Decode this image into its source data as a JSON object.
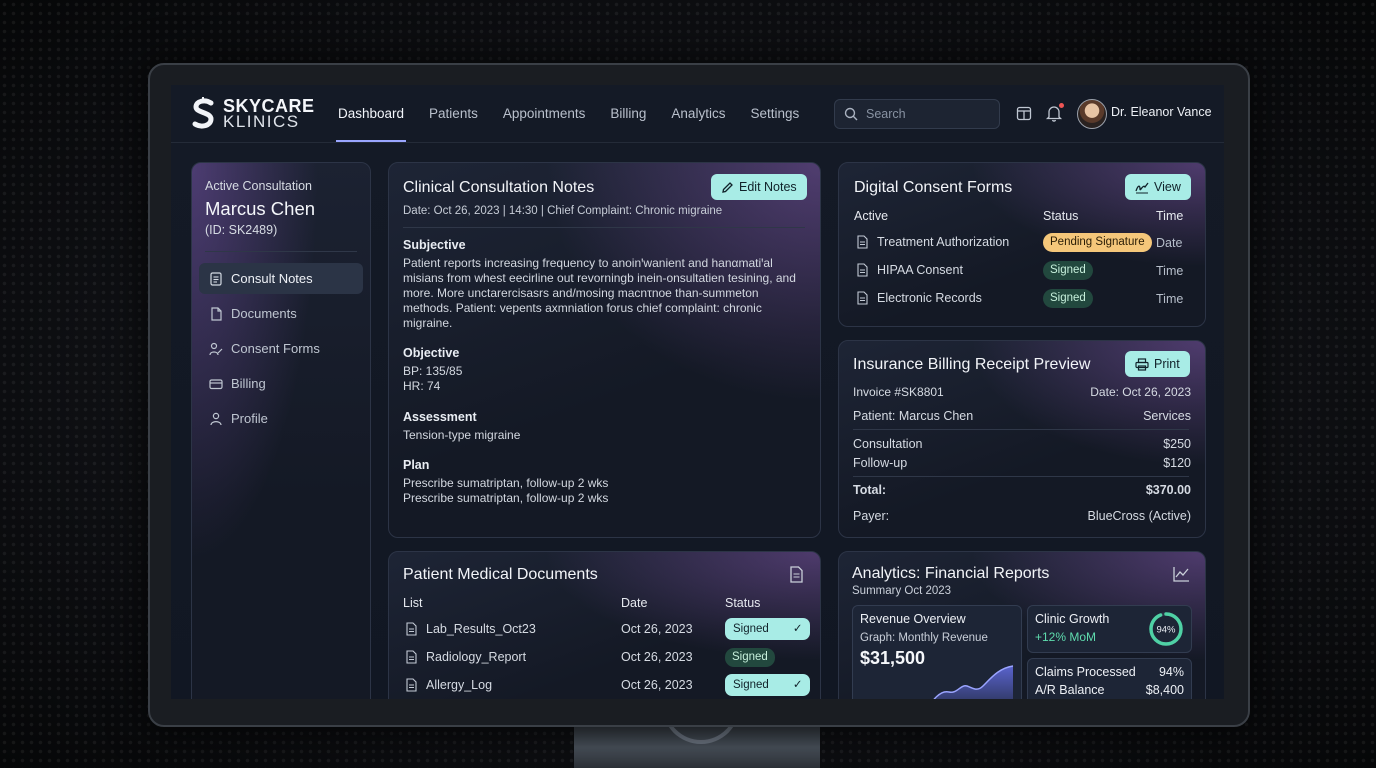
{
  "brand": {
    "line1": "SKYCARE",
    "line2": "KLINICS"
  },
  "nav": {
    "items": [
      "Dashboard",
      "Patients",
      "Appointments",
      "Billing",
      "Analytics",
      "Settings"
    ],
    "active": "Dashboard"
  },
  "search": {
    "placeholder": "Search"
  },
  "user": {
    "name": "Dr. Eleanor Vance"
  },
  "sidebar": {
    "context_label": "Active Consultation",
    "patient_name": "Marcus Chen",
    "patient_id": "(ID: SK2489)",
    "items": [
      {
        "label": "Consult Notes",
        "icon": "note-icon",
        "active": true
      },
      {
        "label": "Documents",
        "icon": "document-icon"
      },
      {
        "label": "Consent Forms",
        "icon": "user-sign-icon"
      },
      {
        "label": "Billing",
        "icon": "credit-card-icon"
      },
      {
        "label": "Profile",
        "icon": "person-icon"
      }
    ]
  },
  "notes": {
    "title": "Clinical Consultation Notes",
    "edit_label": "Edit Notes",
    "meta": "Date: Oct 26, 2023 | 14:30 | Chief Complaint: Chronic migraine",
    "subjective_h": "Subjective",
    "subjective": [
      "Patient reports increasing frequency to anoinꞌwanient and hanαmatiꞌal",
      "misians from whest eecirline out revorningb inein-onsultatien tesining, and",
      "more. More unctarercisasrs and/mosing macnτnoe than-summeton",
      "methods. Patient: vepents axmniation forus chief complaint: chronic",
      "migraine."
    ],
    "objective_h": "Objective",
    "objective": [
      "BP: 135/85",
      "HR: 74"
    ],
    "assessment_h": "Assessment",
    "assessment": "Tension-type migraine",
    "plan_h": "Plan",
    "plan": [
      "Prescribe sumatriptan, follow-up 2 wks",
      "Prescribe sumatriptan, follow-up 2 wks"
    ]
  },
  "consent": {
    "title": "Digital Consent Forms",
    "view_label": "View",
    "headers": [
      "Active",
      "Status",
      "Time"
    ],
    "rows": [
      {
        "name": "Treatment Authorization",
        "status": "Pending Signature",
        "tone": "amber",
        "time": "Date"
      },
      {
        "name": "HIPAA Consent",
        "status": "Signed",
        "tone": "green",
        "time": "Time"
      },
      {
        "name": "Electronic Records",
        "status": "Signed",
        "tone": "green",
        "time": "Time"
      }
    ]
  },
  "billing": {
    "title": "Insurance Billing Receipt Preview",
    "print_label": "Print",
    "invoice": "Invoice #SK8801",
    "date": "Date: Oct 26, 2023",
    "patient": "Patient: Marcus Chen",
    "services_h": "Services",
    "lines": [
      {
        "label": "Consultation",
        "amount": "$250"
      },
      {
        "label": "Follow-up",
        "amount": "$120"
      }
    ],
    "total_label": "Total:",
    "total": "$370.00",
    "payer_label": "Payer:",
    "payer": "BlueCross (Active)"
  },
  "documents": {
    "title": "Patient Medical Documents",
    "headers": [
      "List",
      "Date",
      "Status"
    ],
    "rows": [
      {
        "name": "Lab_Results_Oct23",
        "date": "Oct 26, 2023",
        "status": "Signed",
        "tone": "mint",
        "check": true
      },
      {
        "name": "Radiology_Report",
        "date": "Oct 26, 2023",
        "status": "Signed",
        "tone": "green",
        "check": false
      },
      {
        "name": "Allergy_Log",
        "date": "Oct 26, 2023",
        "status": "Signed",
        "tone": "mint",
        "check": true
      }
    ]
  },
  "analytics": {
    "title": "Analytics: Financial Reports",
    "subtitle": "Summary Oct 2023",
    "revenue": {
      "title": "Revenue Overview",
      "graph_label": "Graph: Monthly Revenue",
      "value": "$31,500"
    },
    "growth": {
      "title": "Clinic Growth",
      "delta": "+12% MoM",
      "ring_value": "94%",
      "ring_fraction": 0.94
    },
    "claims": {
      "label": "Claims Processed",
      "value": "94%"
    },
    "ar": {
      "label": "A/R Balance",
      "value": "$8,400"
    }
  },
  "colors": {
    "accent": "#a8ece6",
    "nav_underline": "#9aa6ff",
    "pending": "#f5c77a",
    "signed": "#22483e",
    "growth_ring": "#4fd1a5"
  }
}
